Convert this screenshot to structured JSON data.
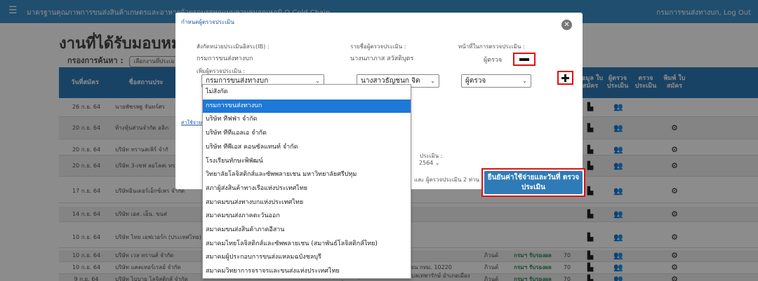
{
  "topbar": {
    "menu_icon": "☰",
    "title": "มาตรฐานคุณภาพการขนส่งสินค้าเกษตรและอาหารด้วยรถบรรทุกแบบควบคุมอุณหภูมิ Q Cold Chain",
    "user": "กรมการขนส่งทางบก, Log Out"
  },
  "page": {
    "title": "งานที่ได้รับมอบหม",
    "filter_label": "กรองการค้นหา :",
    "filter_value": "เลือกงานที่ประเม"
  },
  "table": {
    "headers": [
      "วันที่สมัคร",
      "ชื่อสถานประ",
      "ข้อมูล ใบ สมัคร",
      "ผู้ตรวจ ประเมิน",
      "ตรวจ ประเมิน",
      "พิมพ์ ใบ สมัคร"
    ],
    "rows": [
      {
        "date": "26 ก.ย. 64",
        "name": "นายพัชรพฐ จันทร์ศร",
        "address": "",
        "region": "",
        "status": "",
        "num": ""
      },
      {
        "date": "20 ก.ย. 64",
        "name": "ห้างหุ้นส่วนจำกัด อลิภ",
        "address": "",
        "region": "",
        "status": "",
        "num": ""
      },
      {
        "date": "20 ก.ย. 64",
        "name": "บริษัท ทรานสเพิร์ จำกั",
        "address": "",
        "region": "",
        "status": "",
        "num": ""
      },
      {
        "date": "20 ก.ย. 64",
        "name": "บริษัท 3-เซฟ ลอโลสเ ทรานสปอร์ต จำกัด",
        "address": "",
        "region": "",
        "status": "",
        "num": ""
      },
      {
        "date": "17 ก.ย. 64",
        "name": "บริษัทอินเตอร์เอ็กซ์เพร จำกัด",
        "address": "",
        "region": "",
        "status": "",
        "num": ""
      },
      {
        "date": "14 ก.ย. 64",
        "name": "บริษัท เอส. เอ็น. ขนส่",
        "address": "",
        "region": "",
        "status": "",
        "num": ""
      },
      {
        "date": "10 ก.ย. 64",
        "name": "บริษัท ไทย เอฟเวอร์ก (ประเทศไทย) จำกัด",
        "address": "",
        "region": "",
        "status": "",
        "num": ""
      },
      {
        "date": "10 ก.ย. 64",
        "name": "บริษัท เวล ทรานส์ จำกัด",
        "address": "20",
        "region": "ภิวนด์",
        "status": "กรมฯ รับรองผล",
        "num": "70"
      },
      {
        "date": "10 ก.ย. 64",
        "name": "บริษัท แคตเทอร์เรลย์ จำกัด",
        "address": "120/81 ม.6 แขวงท่าแร้ง เขตบางเขน กทม. 10220",
        "region": "ภิวนด์",
        "status": "กรมฯ รับรองผล",
        "num": "70"
      },
      {
        "date": "9 ก.ย. 64",
        "name": "บริษัท ไบบาย โลจิสติกส์ จำกัด",
        "address": "เลขที่ 247 หมู่ที่ 1 ถนนพาทรัพย์ ตำบลเทพารักษ์ อำเภอเมืองสมุทรปราการ",
        "region": "ภิวนด์",
        "status": "กรมฯ รับรองผล",
        "num": "70"
      }
    ]
  },
  "modal": {
    "title": "กำหนดผู้ตรวจประเมิน",
    "close_icon": "✕",
    "agency_label": "สังกัดหน่วยประเมินอิสระ(IB) :",
    "agency_value": "กรมการขนส่งทางบก",
    "inspector_label": "รายชื่อผู้ตรวจประเมิน :",
    "inspector_value": "นางนภาภาส สวัสดิบุตร",
    "duty_label": "หน้าที่ในการตรวจประเมิน :",
    "duty_value": "ผู้ตรวจ",
    "add_label": "เพิ่มผู้ตรวจประเมิน :",
    "dd_agency": "กรมการขนส่งทางบก",
    "dd_person": "นางสาวธัญชนก จิต",
    "dd_role": "ผู้ตรวจ",
    "caret": "⌄",
    "link_text": "ค่าใช้จ่ายและวัน",
    "date_label": "ประเมิน :",
    "date_value": "2564",
    "footer_text": "และ ผู้ตรวจประเมิน 2 ท่าน",
    "confirm_label": "ยืนยันค่าใช้จ่ายและวันที่ ตรวจประเมิน"
  },
  "dropdown": {
    "selected_index": 1,
    "options": [
      "ไม่สังกัด",
      "กรมการขนส่งทางบก",
      "บริษัท ทีฟฟ่า จำกัด",
      "บริษัท ทีทีแอลเอ จำกัด",
      "บริษัท ทีพีเอส คอนซัลแทนท์ จำกัด",
      "โรงเรียนทักษะพิพัฒน์",
      "วิทยาลัยโลจิสติกส์และซัพพลายเชน มหาวิทยาลัยศรีปทุม",
      "สภาผู้ส่งสินค้าทางเรือแห่งประเทศไทย",
      "สมาคมขนส่งทางบกแห่งประเทศไทย",
      "สมาคมขนส่งภาคตะวันออก",
      "สมาคมขนส่งสินค้าภาคอีสาน",
      "สมาคมไทยโลจิสติกส์และซัพพลายเชน (สมาพันธ์โลจิสติกส์ไทย)",
      "สมาคมผู้ประกอบการขนส่งแหลมฉบังชลบุรี",
      "สมาคมวิทยาการจราจรและขนส่งแห่งประเทศไทย"
    ]
  }
}
